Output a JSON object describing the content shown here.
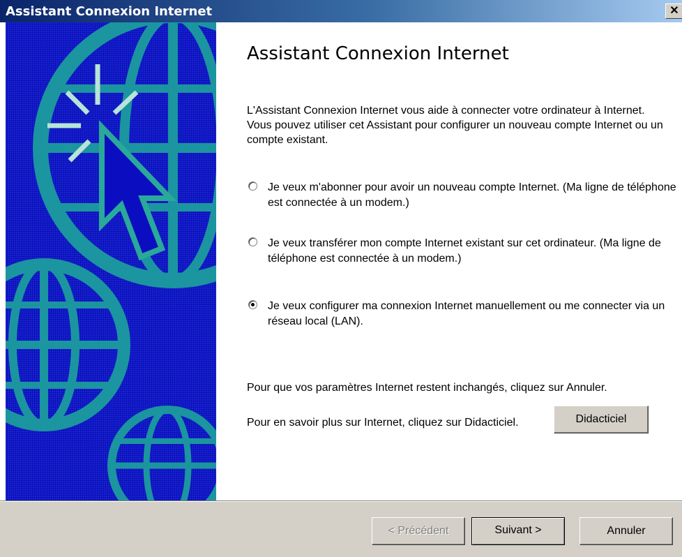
{
  "window": {
    "title": "Assistant Connexion Internet",
    "close_label": "✕"
  },
  "banner": {
    "background_color": "#0b0ec0",
    "accent_color": "#2aa89a",
    "icons": [
      "globe-icon",
      "cursor-arrow-icon"
    ]
  },
  "content": {
    "heading": "Assistant Connexion Internet",
    "intro": "L'Assistant Connexion Internet vous aide à  connecter votre ordinateur à Internet. Vous pouvez utiliser cet Assistant pour configurer un nouveau compte Internet ou un compte existant.",
    "options": [
      {
        "label": "Je veux m'abonner pour avoir un nouveau compte Internet. (Ma ligne de téléphone est connectée à un modem.)",
        "selected": false
      },
      {
        "label": "Je veux transférer mon compte Internet existant sur cet ordinateur. (Ma ligne de téléphone est connectée à un modem.)",
        "selected": false
      },
      {
        "label": "Je veux configurer ma connexion Internet manuellement ou me connecter via un réseau local (LAN).",
        "selected": true
      }
    ],
    "cancel_note": "Pour que vos paramètres Internet restent inchangés, cliquez sur Annuler.",
    "learn_note": "Pour en savoir plus sur Internet, cliquez sur Didacticiel.",
    "tutorial_button": "Didacticiel"
  },
  "footer": {
    "prev_button": "< Précédent",
    "next_button": "Suivant >",
    "cancel_button": "Annuler",
    "prev_enabled": false
  }
}
